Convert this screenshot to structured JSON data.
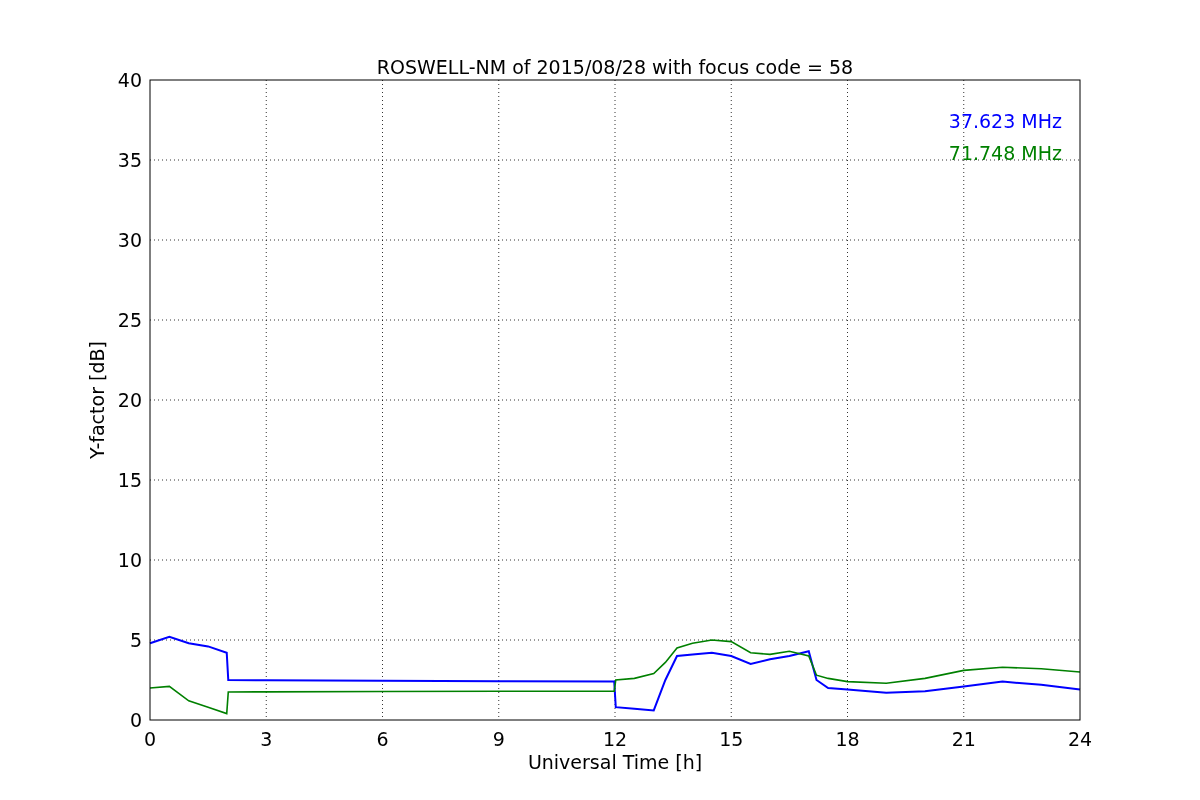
{
  "chart_data": {
    "type": "line",
    "title": "ROSWELL-NM of 2015/08/28 with focus code = 58",
    "xlabel": "Universal Time [h]",
    "ylabel": "Y-factor [dB]",
    "x": [
      0,
      0.5,
      1,
      1.5,
      1.98,
      2.02,
      3,
      6,
      9,
      11.98,
      12.02,
      12.5,
      13,
      13.3,
      13.6,
      14,
      14.5,
      15,
      15.5,
      16,
      16.5,
      17,
      17.2,
      17.5,
      18,
      19,
      20,
      21,
      22,
      23,
      24
    ],
    "series": [
      {
        "name": "37.623 MHz",
        "color": "#0000ff",
        "values": [
          4.8,
          5.2,
          4.8,
          4.6,
          4.2,
          2.5,
          2.48,
          2.45,
          2.42,
          2.4,
          0.8,
          0.7,
          0.6,
          2.5,
          4.0,
          4.1,
          4.2,
          4.0,
          3.5,
          3.8,
          4.0,
          4.3,
          2.5,
          2.0,
          1.9,
          1.7,
          1.8,
          2.1,
          2.4,
          2.2,
          1.9
        ]
      },
      {
        "name": "71.748 MHz",
        "color": "#008000",
        "values": [
          2.0,
          2.1,
          1.2,
          0.8,
          0.4,
          1.75,
          1.76,
          1.78,
          1.8,
          1.8,
          2.5,
          2.6,
          2.9,
          3.6,
          4.5,
          4.8,
          5.0,
          4.9,
          4.2,
          4.1,
          4.3,
          4.0,
          2.8,
          2.6,
          2.4,
          2.3,
          2.6,
          3.1,
          3.3,
          3.2,
          3.0
        ]
      }
    ],
    "grid": true,
    "xlim": [
      0,
      24
    ],
    "ylim": [
      0,
      40
    ],
    "xticks": [
      0,
      3,
      6,
      9,
      12,
      15,
      18,
      21,
      24
    ],
    "yticks": [
      0,
      5,
      10,
      15,
      20,
      25,
      30,
      35,
      40
    ]
  }
}
